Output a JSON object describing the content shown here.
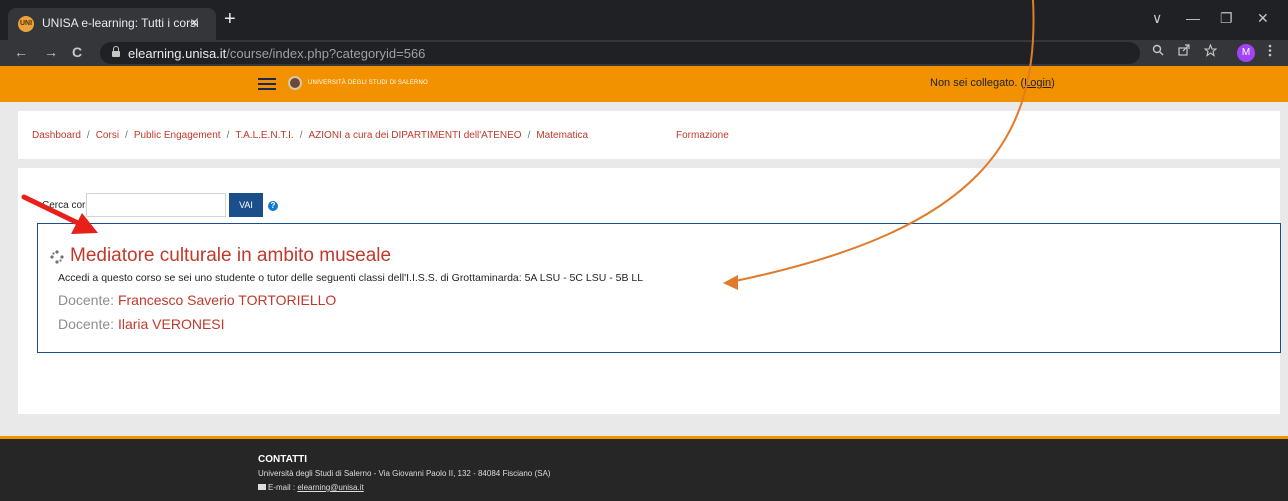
{
  "browser": {
    "tab_title": "UNISA e-learning: Tutti i corsi",
    "tab_close": "×",
    "new_tab": "+",
    "favicon_text": "UNI",
    "url_host": "elearning.unisa.it",
    "url_path": "/course/index.php?categoryid=566",
    "profile_initial": "M",
    "window_controls": [
      "∨",
      "—",
      "❐",
      "✕"
    ],
    "nav": [
      "←",
      "→",
      "C"
    ],
    "toolbar_icons": [
      "zoom-icon",
      "share-icon",
      "star-icon",
      "menu-icon"
    ]
  },
  "header": {
    "university_name": "UNIVERSITÀ DEGLI STUDI DI SALERNO",
    "login_prefix": "Non sei collegato. (",
    "login_link": "Login",
    "login_suffix": ")",
    "accent": "#f39200"
  },
  "breadcrumb": {
    "items": [
      "Dashboard",
      "Corsi",
      "Public Engagement",
      "T.A.L.E.N.T.I.",
      "AZIONI a cura dei DIPARTIMENTI dell'ATENEO",
      "Matematica"
    ],
    "separator": "/",
    "extra": "Formazione"
  },
  "search": {
    "label": "Cerca corsi",
    "value": "",
    "button": "VAI",
    "help": "?"
  },
  "course": {
    "title": "Mediatore culturale in ambito museale",
    "description": "Accedi a questo corso se sei uno studente o tutor delle seguenti classi dell'I.I.S.S. di Grottaminarda: 5A LSU - 5C LSU - 5B LL",
    "teachers": [
      {
        "role": "Docente: ",
        "name": "Francesco Saverio TORTORIELLO"
      },
      {
        "role": "Docente: ",
        "name": "Ilaria VERONESI"
      }
    ]
  },
  "footer": {
    "title": "CONTATTI",
    "address": "Università degli Studi di Salerno - Via Giovanni Paolo II, 132 - 84084 Fisciano (SA)",
    "email_label": "E-mail : ",
    "email": "elearning@unisa.it"
  },
  "annotations": {
    "red_arrow_color": "#e8201a",
    "orange_arrow_color": "#e07b2a"
  }
}
